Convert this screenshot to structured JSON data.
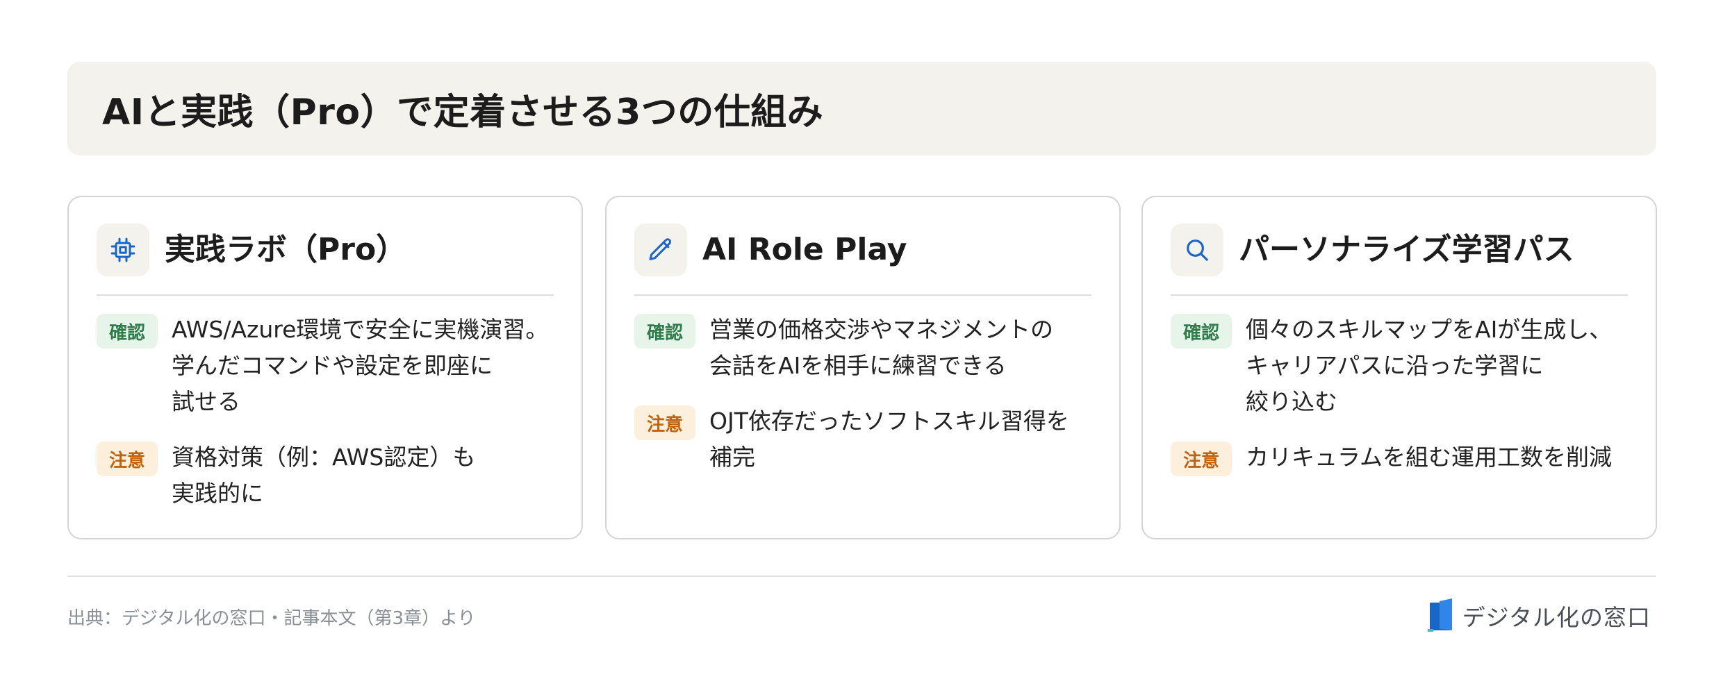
{
  "header": {
    "title": "AIと実践（Pro）で定着させる3つの仕組み"
  },
  "colors": {
    "header_bg": "#f4f2ec",
    "icon_blue": "#1a66c8",
    "confirm_bg": "#e7f4ea",
    "confirm_fg": "#2e7d4a",
    "caution_bg": "#fcefdc",
    "caution_fg": "#c0620e"
  },
  "cards": [
    {
      "icon": "chip-icon",
      "title": "実践ラボ（Pro）",
      "confirm_label": "確認",
      "confirm_text": "AWS/Azure環境で安全に実機演習。\n学んだコマンドや設定を即座に\n試せる",
      "caution_label": "注意",
      "caution_text": "資格対策（例：AWS認定）も\n実践的に"
    },
    {
      "icon": "pencil-icon",
      "title": "AI Role Play",
      "confirm_label": "確認",
      "confirm_text": "営業の価格交渉やマネジメントの\n会話をAIを相手に練習できる",
      "caution_label": "注意",
      "caution_text": "OJT依存だったソフトスキル習得を\n補完"
    },
    {
      "icon": "search-icon",
      "title": "パーソナライズ学習パス",
      "confirm_label": "確認",
      "confirm_text": "個々のスキルマップをAIが生成し、\nキャリアパスに沿った学習に\n絞り込む",
      "caution_label": "注意",
      "caution_text": "カリキュラムを組む運用工数を削減"
    }
  ],
  "footer": {
    "source": "出典：デジタル化の窓口・記事本文（第3章）より",
    "brand": "デジタル化の窓口"
  }
}
